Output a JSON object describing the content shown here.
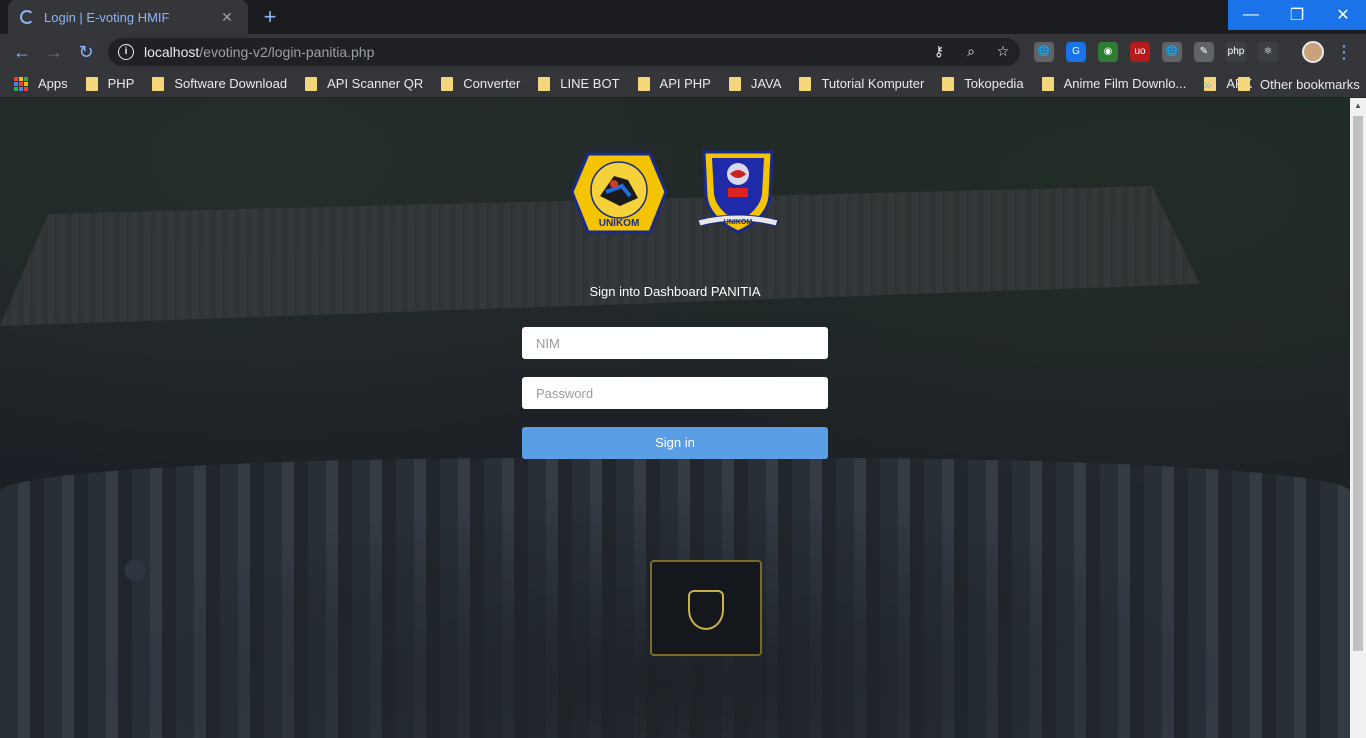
{
  "browser": {
    "tab_title": "Login | E-voting HMIF",
    "tab_close": "✕",
    "new_tab": "+",
    "url_host": "localhost",
    "url_path": "/evoting-v2/login-panitia.php",
    "window_min": "—",
    "window_max": "❐",
    "window_close": "✕",
    "extensions": [
      "globe-ext",
      "translate-ext",
      "color-ext",
      "ublock-ext",
      "world-ext",
      "edit-ext",
      "php-ext",
      "react-ext"
    ],
    "ext_labels": [
      "🌐",
      "G",
      "◉",
      "uo",
      "🌐",
      "✎",
      "php",
      "⚛"
    ],
    "ext_colors": [
      "#5f6368",
      "#1a73e8",
      "#2e7d32",
      "#b71c1c",
      "#5f6368",
      "#5f6368",
      "#3c4043",
      "#3c4043"
    ]
  },
  "bookmarks": {
    "apps_label": "Apps",
    "items": [
      "PHP",
      "Software Download",
      "API Scanner QR",
      "Converter",
      "LINE BOT",
      "API PHP",
      "JAVA",
      "Tutorial Komputer",
      "Tokopedia",
      "Anime Film Downlo...",
      "APK"
    ],
    "more": "»",
    "other": "Other bookmarks"
  },
  "page": {
    "heading": "Sign into Dashboard PANITIA",
    "nim_placeholder": "NIM",
    "password_placeholder": "Password",
    "signin_label": "Sign in",
    "logo_unikom_text": "UNIKOM",
    "logo_unikom_ring": "UNIVERSITAS KOMPUTER INDONESIA",
    "logo_hmif_text": "UNIKOM"
  },
  "colors": {
    "accent": "#8ab4f8",
    "button": "#5a9fe6",
    "window_controls": "#1a73e8"
  }
}
